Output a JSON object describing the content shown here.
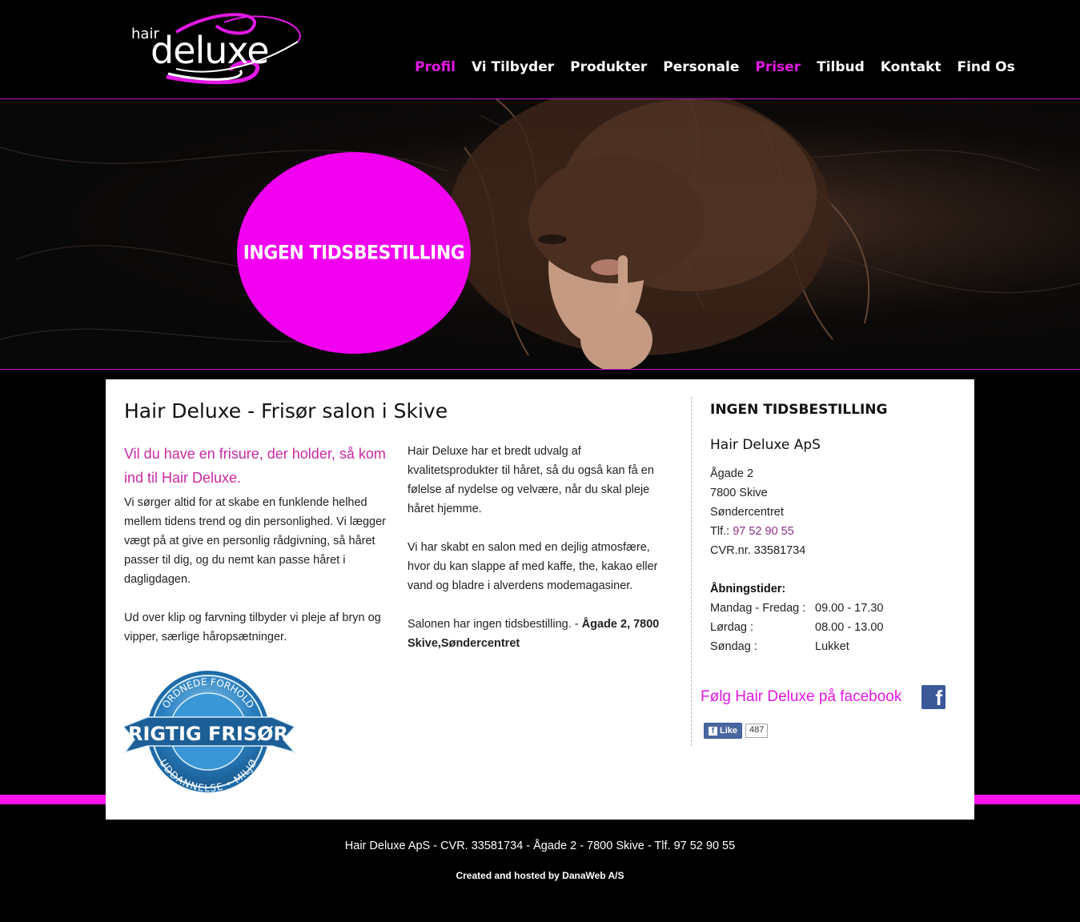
{
  "brand": {
    "logo_small": "hair",
    "logo_large": "deluxe"
  },
  "nav": {
    "items": [
      {
        "label": "Profil",
        "active": true
      },
      {
        "label": "Vi Tilbyder",
        "active": false
      },
      {
        "label": "Produkter",
        "active": false
      },
      {
        "label": "Personale",
        "active": false
      },
      {
        "label": "Priser",
        "active": true
      },
      {
        "label": "Tilbud",
        "active": false
      },
      {
        "label": "Kontakt",
        "active": false
      },
      {
        "label": "Find Os",
        "active": false
      }
    ]
  },
  "banner": {
    "bubble_text": "INGEN TIDSBESTILLING"
  },
  "main": {
    "title": "Hair Deluxe - Frisør salon i Skive",
    "lead": "Vil du have en frisure, der holder, så kom ind til Hair Deluxe.",
    "col1_p1": "Vi sørger altid for at skabe en funklende helhed mellem tidens trend og din personlighed. Vi lægger vægt på at give en personlig rådgivning, så håret passer til dig, og du nemt kan passe håret i dagligdagen.",
    "col1_p2": "Ud over klip og farvning tilbyder vi pleje af bryn og vipper, særlige håropsætninger.",
    "col2_p1": "Hair Deluxe har et bredt udvalg af kvalitetsprodukter til håret, så du også kan få en følelse af nydelse og velvære, når du skal pleje håret hjemme.",
    "col2_p2": "Vi har skabt en salon med en dejlig atmosfære, hvor du kan slappe af med kaffe, the, kakao eller vand og bladre i alverdens modemagasiner.",
    "col2_p3_normal": "Salonen har ingen tidsbestilling. - ",
    "col2_p3_bold": "Ågade 2, 7800 Skive,Søndercentret",
    "badge": {
      "top": "ORDNEDE FORHOLD",
      "center": "RIGTIG FRISØR",
      "bottom": "UDDANNELSE • MILJØ"
    }
  },
  "sidebar": {
    "title": "INGEN TIDSBESTILLING",
    "company": "Hair Deluxe ApS",
    "street": "Ågade 2",
    "city": "7800 Skive",
    "center": "Søndercentret",
    "phone_label": "Tlf.: ",
    "phone": "97 52 90 55",
    "cvr": "CVR.nr. 33581734",
    "hours_title": "Åbningstider:",
    "hours": [
      {
        "day": "Mandag - Fredag :",
        "time": "09.00 - 17.30"
      },
      {
        "day": "Lørdag :",
        "time": "08.00 - 13.00"
      },
      {
        "day": "Søndag :",
        "time": "Lukket"
      }
    ],
    "facebook_text": "Følg Hair Deluxe på facebook",
    "like_label": "Like",
    "like_count": "487"
  },
  "footer": {
    "line1": "Hair Deluxe ApS - CVR. 33581734 - Ågade 2 - 7800 Skive - Tlf. 97 52 90 55",
    "line2": "Created and hosted by DanaWeb A/S"
  },
  "colors": {
    "accent": "#e219e4",
    "bubble": "#f200f0",
    "stripe": "#ff14f0",
    "lead": "#c92aa2"
  }
}
